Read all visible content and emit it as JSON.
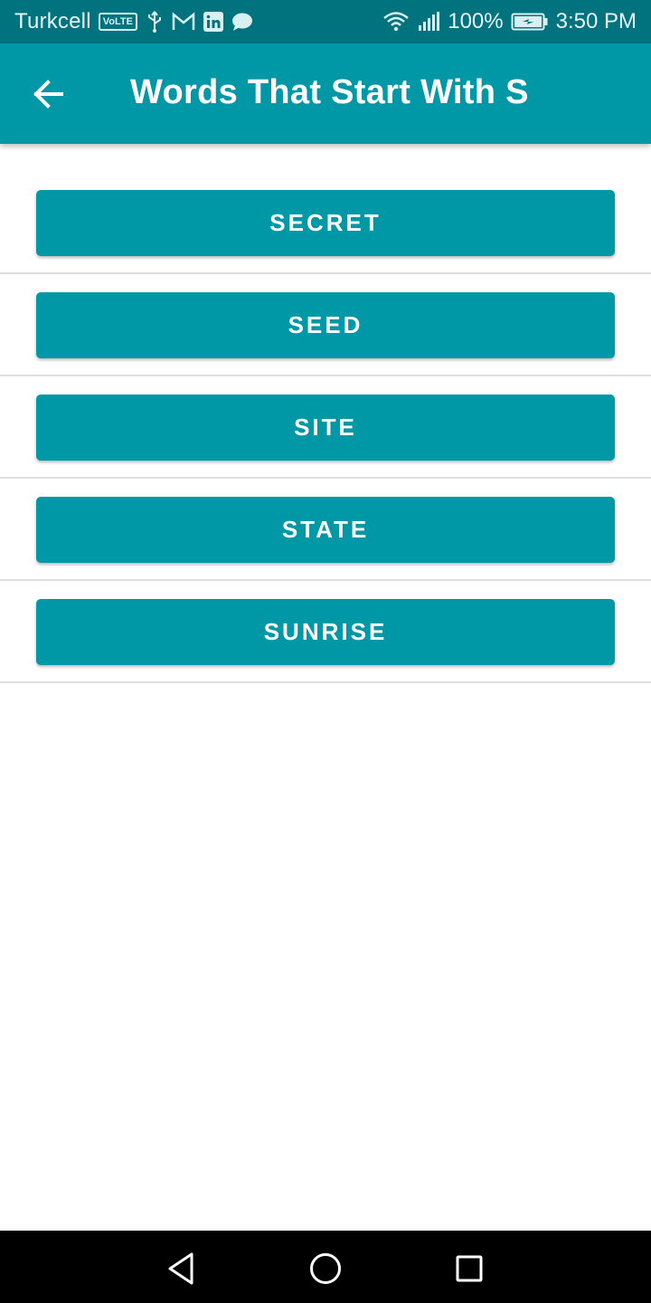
{
  "status_bar": {
    "carrier": "Turkcell",
    "volte": "VoLTE",
    "battery": "100%",
    "time": "3:50 PM",
    "icons": [
      "volte-icon",
      "usb-icon",
      "gmail-icon",
      "linkedin-icon",
      "chat-icon",
      "wifi-icon",
      "signal-icon",
      "battery-charging-icon"
    ]
  },
  "app_bar": {
    "title": "Words That Start With S",
    "back_icon": "arrow-left-icon"
  },
  "words": [
    {
      "label": "Secret"
    },
    {
      "label": "Seed"
    },
    {
      "label": "Site"
    },
    {
      "label": "State"
    },
    {
      "label": "Sunrise"
    }
  ],
  "nav_bar": {
    "icons": [
      "back-triangle-icon",
      "home-circle-icon",
      "recents-square-icon"
    ]
  },
  "colors": {
    "status_bar": "#00737f",
    "primary": "#0097a7",
    "divider": "#dedede",
    "nav_bar": "#000000"
  }
}
